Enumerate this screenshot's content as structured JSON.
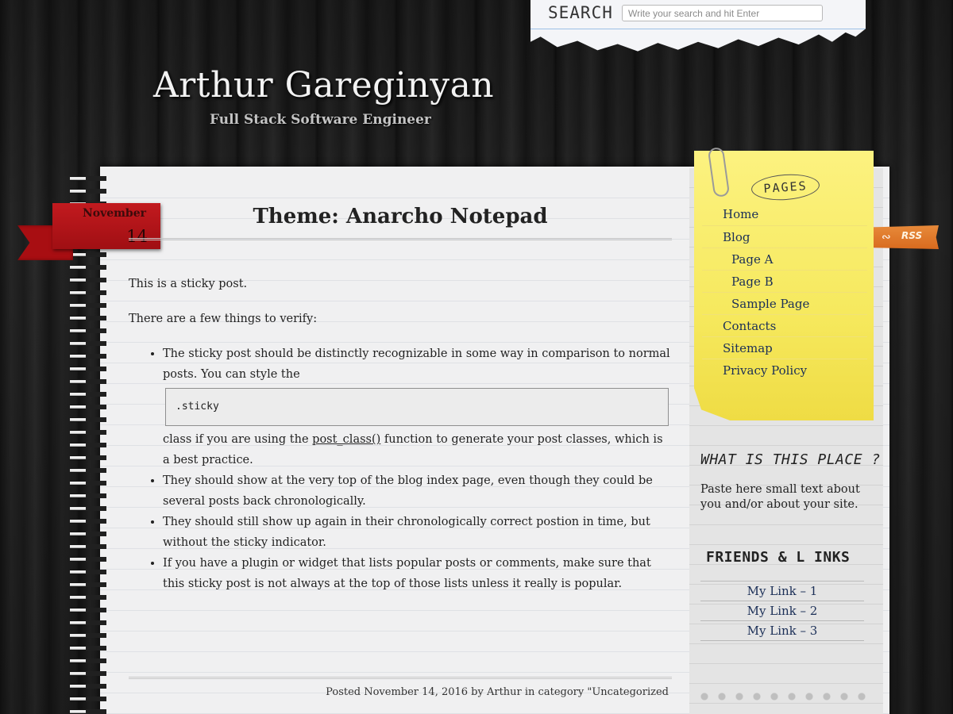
{
  "search": {
    "label": "SEARCH",
    "placeholder": "Write your search and hit Enter"
  },
  "header": {
    "title": "Arthur Gareginyan",
    "tagline": "Full Stack Software Engineer"
  },
  "post": {
    "date_month": "November",
    "date_day": "14",
    "title": "Theme: Anarcho Notepad",
    "intro": "This is a sticky post.",
    "lead": "There are a few things to verify:",
    "bullet1_a": "The sticky post should be distinctly recognizable in some way in comparison to normal posts. You can style the",
    "code": ".sticky",
    "bullet1_b_pre": "class if you are using the ",
    "bullet1_b_link": "post_class()",
    "bullet1_b_post": " function to generate your post classes, which is a best practice.",
    "bullet2": "They should show at the very top of the blog index page, even though they could be several posts back chronologically.",
    "bullet3": "They should still show up again in their chronologically correct postion in time, but without the sticky indicator.",
    "bullet4": "If you have a plugin or widget that lists popular posts or comments, make sure that this sticky post is not always at the top of those lists unless it really is popular.",
    "footer": "Posted November 14, 2016 by Arthur in category \"Uncategorized"
  },
  "sidebar": {
    "pages_title": "PAGES",
    "pages": [
      "Home",
      "Blog",
      "Page A",
      "Page B",
      "Sample Page",
      "Contacts",
      "Sitemap",
      "Privacy Policy"
    ],
    "rss_label": "RSS",
    "about_title": "WHAT IS THIS PLACE ?",
    "about_text": "Paste here small text about you and/or about your site.",
    "links_title": "FRIENDS & L INKS",
    "links": [
      "My Link – 1",
      "My Link – 2",
      "My Link – 3"
    ]
  },
  "colors": {
    "ribbon": "#b5151a",
    "sticky_note": "#f7ea62",
    "link": "#1b2f57",
    "rss": "#e07a2c"
  }
}
